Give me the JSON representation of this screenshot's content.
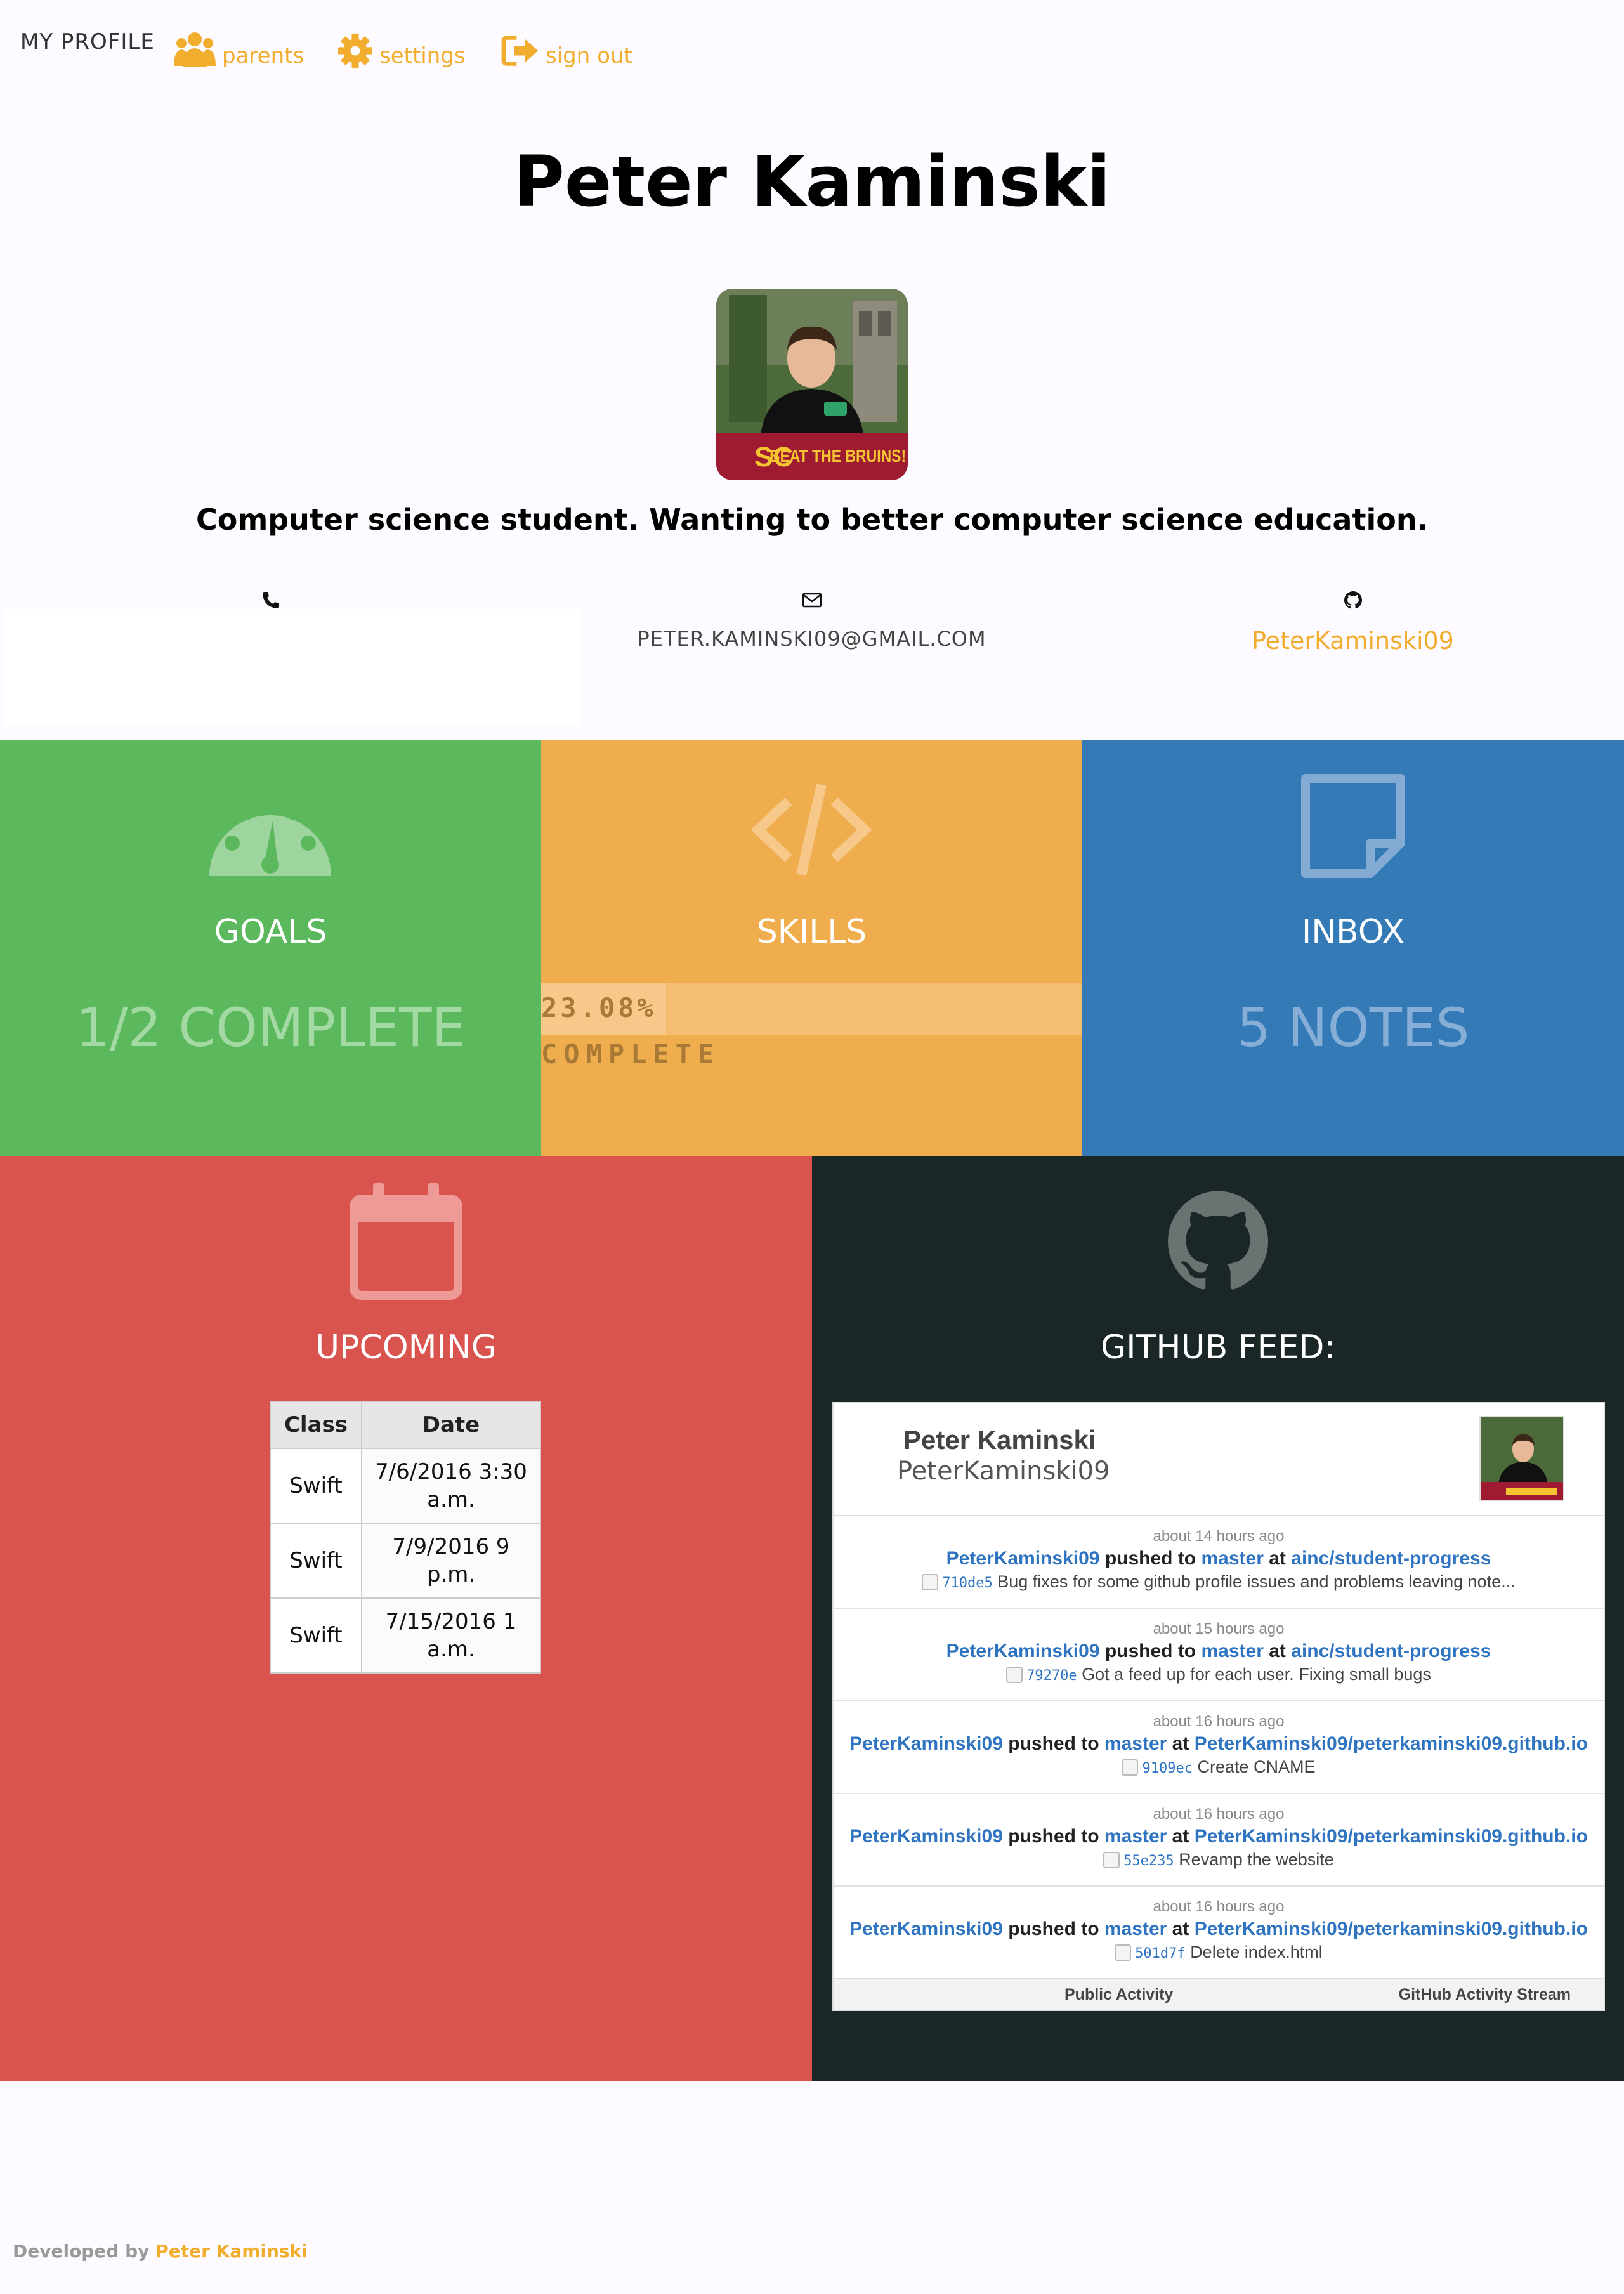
{
  "nav": {
    "brand": "MY PROFILE",
    "items": [
      {
        "label": "parents",
        "icon": "users-icon"
      },
      {
        "label": "settings",
        "icon": "gear-icon"
      },
      {
        "label": "sign out",
        "icon": "sign-out-icon"
      }
    ]
  },
  "profile": {
    "name": "Peter Kaminski",
    "bio": "Computer science student. Wanting to better computer science education.",
    "avatar_caption": "BEAT THE BRUINS!"
  },
  "contact": {
    "phone_icon": "phone-icon",
    "email_icon": "envelope-icon",
    "email": "PETER.KAMINSKI09@GMAIL.COM",
    "github_icon": "github-icon",
    "github_user": "PeterKaminski09"
  },
  "tiles": {
    "goals": {
      "title": "GOALS",
      "stat": "1/2 COMPLETE",
      "icon": "dashboard-icon"
    },
    "skills": {
      "title": "SKILLS",
      "progress_label": "23.08%",
      "progress_sub": "COMPLETE",
      "progress_value": 0.2308,
      "icon": "code-icon"
    },
    "inbox": {
      "title": "INBOX",
      "stat": "5 NOTES",
      "icon": "sticky-note-icon"
    },
    "upcoming": {
      "title": "UPCOMING",
      "icon": "calendar-icon"
    },
    "github": {
      "title": "GITHUB FEED:",
      "icon": "github-icon"
    }
  },
  "upcoming_table": {
    "headers": [
      "Class",
      "Date"
    ],
    "rows": [
      {
        "cls": "Swift",
        "date": "7/6/2016 3:30 a.m."
      },
      {
        "cls": "Swift",
        "date": "7/9/2016 9 p.m."
      },
      {
        "cls": "Swift",
        "date": "7/15/2016 1 a.m."
      }
    ]
  },
  "github_widget": {
    "name": "Peter Kaminski",
    "user": "PeterKaminski09",
    "events": [
      {
        "ago": "about 14 hours ago",
        "user": "PeterKaminski09",
        "verb": "pushed to",
        "branch": "master",
        "at": "at",
        "repo": "ainc/student-progress",
        "sha": "710de5",
        "msg": "Bug fixes for some github profile issues and problems leaving note..."
      },
      {
        "ago": "about 15 hours ago",
        "user": "PeterKaminski09",
        "verb": "pushed to",
        "branch": "master",
        "at": "at",
        "repo": "ainc/student-progress",
        "sha": "79270e",
        "msg": "Got a feed up for each user. Fixing small bugs"
      },
      {
        "ago": "about 16 hours ago",
        "user": "PeterKaminski09",
        "verb": "pushed to",
        "branch": "master",
        "at": "at",
        "repo": "PeterKaminski09/peterkaminski09.github.io",
        "sha": "9109ec",
        "msg": "Create CNAME"
      },
      {
        "ago": "about 16 hours ago",
        "user": "PeterKaminski09",
        "verb": "pushed to",
        "branch": "master",
        "at": "at",
        "repo": "PeterKaminski09/peterkaminski09.github.io",
        "sha": "55e235",
        "msg": "Revamp the website"
      },
      {
        "ago": "about 16 hours ago",
        "user": "PeterKaminski09",
        "verb": "pushed to",
        "branch": "master",
        "at": "at",
        "repo": "PeterKaminski09/peterkaminski09.github.io",
        "sha": "501d7f",
        "msg": "Delete index.html"
      }
    ],
    "footer_left": "Public Activity",
    "footer_right": "GitHub Activity Stream"
  },
  "footer": {
    "prefix": "Developed by",
    "author": "Peter Kaminski"
  },
  "colors": {
    "accent": "#f0ad2e",
    "goals": "#5cb85c",
    "skills": "#f0ad4e",
    "inbox": "#337ab7",
    "upcoming": "#d9534f",
    "github": "#1b2727"
  }
}
